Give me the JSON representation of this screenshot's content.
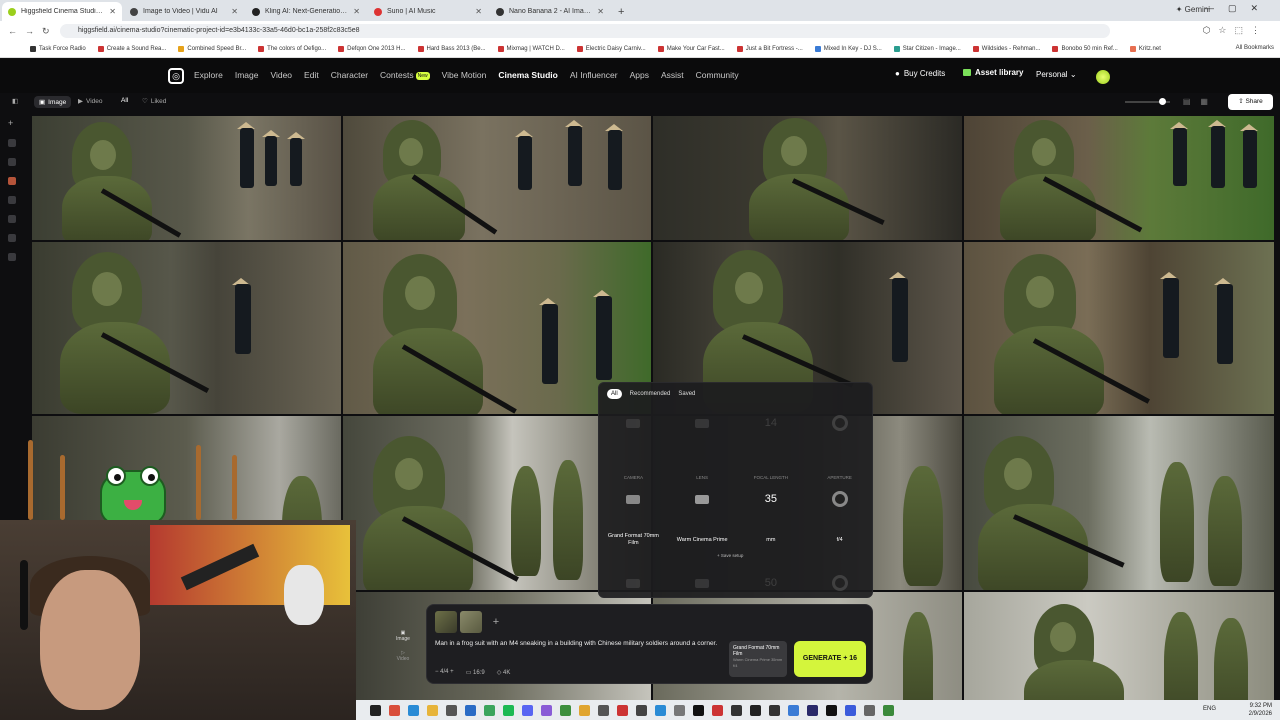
{
  "browser": {
    "tabs": [
      {
        "title": "Higgsfield Cinema Studio | Prof",
        "color": "#9bcf1c",
        "active": true
      },
      {
        "title": "Image to Video | Vidu AI",
        "color": "#444"
      },
      {
        "title": "Kling AI: Next-Generation AI Cr",
        "color": "#222"
      },
      {
        "title": "Suno | AI Music",
        "color": "#d33"
      },
      {
        "title": "Nano Banana 2 - AI Image Gen",
        "color": "#333"
      }
    ],
    "gemini": "Gemini",
    "url": "higgsfield.ai/cinema-studio?cinematic-project-id=e3b4133c-33a5-46d0-bc1a-258f2c83c5e8",
    "bookmarks": [
      "Task Force Radio",
      "Create a Sound Rea...",
      "Combined Speed Br...",
      "The colors of Oefigo...",
      "Defqon One 2013 H...",
      "Hard Bass 2013 (Be...",
      "Mixmag | WATCH D...",
      "Electric Daisy Carniv...",
      "Make Your Car Fast...",
      "Just a Bit Fortress -...",
      "Mixed In Key - DJ S...",
      "Star Citizen - Image...",
      "Wildsides - Rehman...",
      "Bonobo 50 min Ref...",
      "Kritz.net"
    ],
    "all_bookmarks": "All Bookmarks"
  },
  "app": {
    "nav": [
      "Explore",
      "Image",
      "Video",
      "Edit",
      "Character",
      "Contests",
      "Vibe Motion",
      "Cinema Studio",
      "AI Influencer",
      "Apps",
      "Assist",
      "Community"
    ],
    "nav_new_badge": "New",
    "buy_credits": "Buy Credits",
    "asset_library": "Asset library",
    "workspace": "Personal",
    "share": "Share"
  },
  "filters": {
    "image": "Image",
    "video": "Video",
    "all": "All",
    "liked": "Liked"
  },
  "camera_panel": {
    "tabs": [
      "All",
      "Recommended",
      "Saved"
    ],
    "top_row": {
      "focal": "14"
    },
    "headers": {
      "camera": "CAMERA",
      "lens": "LENS",
      "focal": "FOCAL LENGTH",
      "aperture": "APERTURE"
    },
    "focal_value": "35",
    "focal_unit": "mm",
    "camera_name": "Grand Format 70mm Film",
    "lens_name": "Warm Cinema Prime",
    "aperture_value": "f/4",
    "save_setup": "Save setup",
    "bottom_row": {
      "focal": "50"
    }
  },
  "prompt_bar": {
    "text": "Man in a frog suit with an M4 sneaking in a building with Chinese military soldiers around a corner.",
    "count": "4/4",
    "ratio": "16:9",
    "quality": "4K",
    "mode_image": "Image",
    "mode_video": "Video",
    "camcard_title": "Grand Format 70mm Film",
    "camcard_sub": "Warm Cinema Prime 35mm f/4",
    "generate": "GENERATE",
    "generate_cost": "+ 16"
  },
  "taskbar": {
    "lang": "ENG",
    "time": "9:32 PM",
    "date": "2/9/2026"
  }
}
